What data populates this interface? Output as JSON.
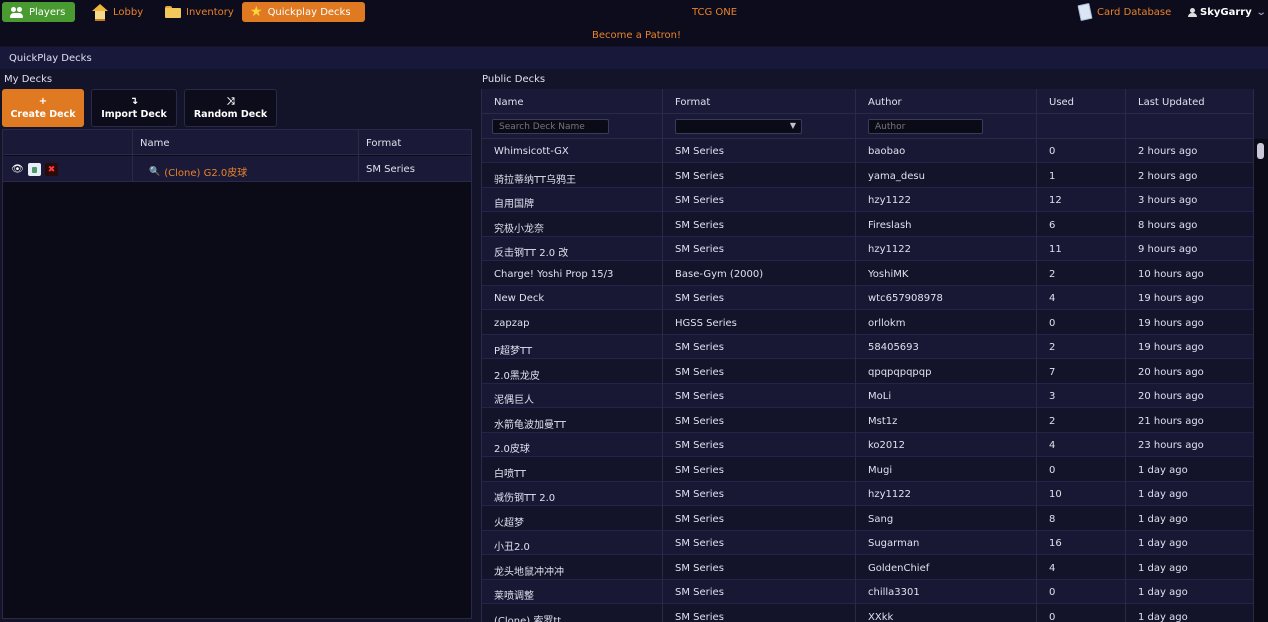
{
  "nav": {
    "players": "Players",
    "lobby": "Lobby",
    "inventory": "Inventory",
    "quickplay": "Quickplay Decks",
    "site_title": "TCG ONE",
    "patron": "Become a Patron!",
    "card_database": "Card Database",
    "username": "SkyGarry"
  },
  "section_title": "QuickPlay Decks",
  "my_decks": {
    "title": "My Decks",
    "buttons": {
      "create": "Create Deck",
      "import": "Import Deck",
      "random": "Random Deck"
    },
    "button_symbols": {
      "create": "+",
      "import": "↴",
      "random": "⤨"
    },
    "headers": {
      "name": "Name",
      "format": "Format"
    },
    "rows": [
      {
        "name": "(Clone) G2.0皮球",
        "format": "SM Series"
      }
    ]
  },
  "public_decks": {
    "title": "Public Decks",
    "headers": {
      "name": "Name",
      "format": "Format",
      "author": "Author",
      "used": "Used",
      "updated": "Last Updated"
    },
    "filters": {
      "name_placeholder": "Search Deck Name",
      "author_placeholder": "Author"
    },
    "rows": [
      {
        "name": "Whimsicott-GX",
        "format": "SM Series",
        "author": "baobao",
        "used": "0",
        "updated": "2 hours ago"
      },
      {
        "name": "骑拉蒂纳TT乌鸦王",
        "format": "SM Series",
        "author": "yama_desu",
        "used": "1",
        "updated": "2 hours ago"
      },
      {
        "name": "自用国牌",
        "format": "SM Series",
        "author": "hzy1122",
        "used": "12",
        "updated": "3 hours ago"
      },
      {
        "name": "究极小龙奈",
        "format": "SM Series",
        "author": "Fireslash",
        "used": "6",
        "updated": "8 hours ago"
      },
      {
        "name": "反击钢TT 2.0 改",
        "format": "SM Series",
        "author": "hzy1122",
        "used": "11",
        "updated": "9 hours ago"
      },
      {
        "name": "Charge! Yoshi Prop 15/3",
        "format": "Base-Gym (2000)",
        "author": "YoshiMK",
        "used": "2",
        "updated": "10 hours ago"
      },
      {
        "name": "New Deck",
        "format": "SM Series",
        "author": "wtc657908978",
        "used": "4",
        "updated": "19 hours ago"
      },
      {
        "name": "zapzap",
        "format": "HGSS Series",
        "author": "orllokm",
        "used": "0",
        "updated": "19 hours ago"
      },
      {
        "name": "P超梦TT",
        "format": "SM Series",
        "author": "58405693",
        "used": "2",
        "updated": "19 hours ago"
      },
      {
        "name": "2.0黑龙皮",
        "format": "SM Series",
        "author": "qpqpqpqpqp",
        "used": "7",
        "updated": "20 hours ago"
      },
      {
        "name": "泥偶巨人",
        "format": "SM Series",
        "author": "MoLi",
        "used": "3",
        "updated": "20 hours ago"
      },
      {
        "name": "水箭龟波加曼TT",
        "format": "SM Series",
        "author": "Mst1z",
        "used": "2",
        "updated": "21 hours ago"
      },
      {
        "name": "2.0皮球",
        "format": "SM Series",
        "author": "ko2012",
        "used": "4",
        "updated": "23 hours ago"
      },
      {
        "name": "白喷TT",
        "format": "SM Series",
        "author": "Mugi",
        "used": "0",
        "updated": "1 day ago"
      },
      {
        "name": "减伤钢TT 2.0",
        "format": "SM Series",
        "author": "hzy1122",
        "used": "10",
        "updated": "1 day ago"
      },
      {
        "name": "火超梦",
        "format": "SM Series",
        "author": "Sang",
        "used": "8",
        "updated": "1 day ago"
      },
      {
        "name": "小丑2.0",
        "format": "SM Series",
        "author": "Sugarman",
        "used": "16",
        "updated": "1 day ago"
      },
      {
        "name": "龙头地鼠冲冲冲",
        "format": "SM Series",
        "author": "GoldenChief",
        "used": "4",
        "updated": "1 day ago"
      },
      {
        "name": "莱喷调整",
        "format": "SM Series",
        "author": "chilla3301",
        "used": "0",
        "updated": "1 day ago"
      },
      {
        "name": "(Clone) 索罗tt",
        "format": "SM Series",
        "author": "XXkk",
        "used": "0",
        "updated": "1 day ago"
      }
    ]
  },
  "colors": {
    "accent": "#e07a22",
    "link": "#e9822b",
    "players_green": "#4a9a32",
    "bg": "#13132a"
  }
}
